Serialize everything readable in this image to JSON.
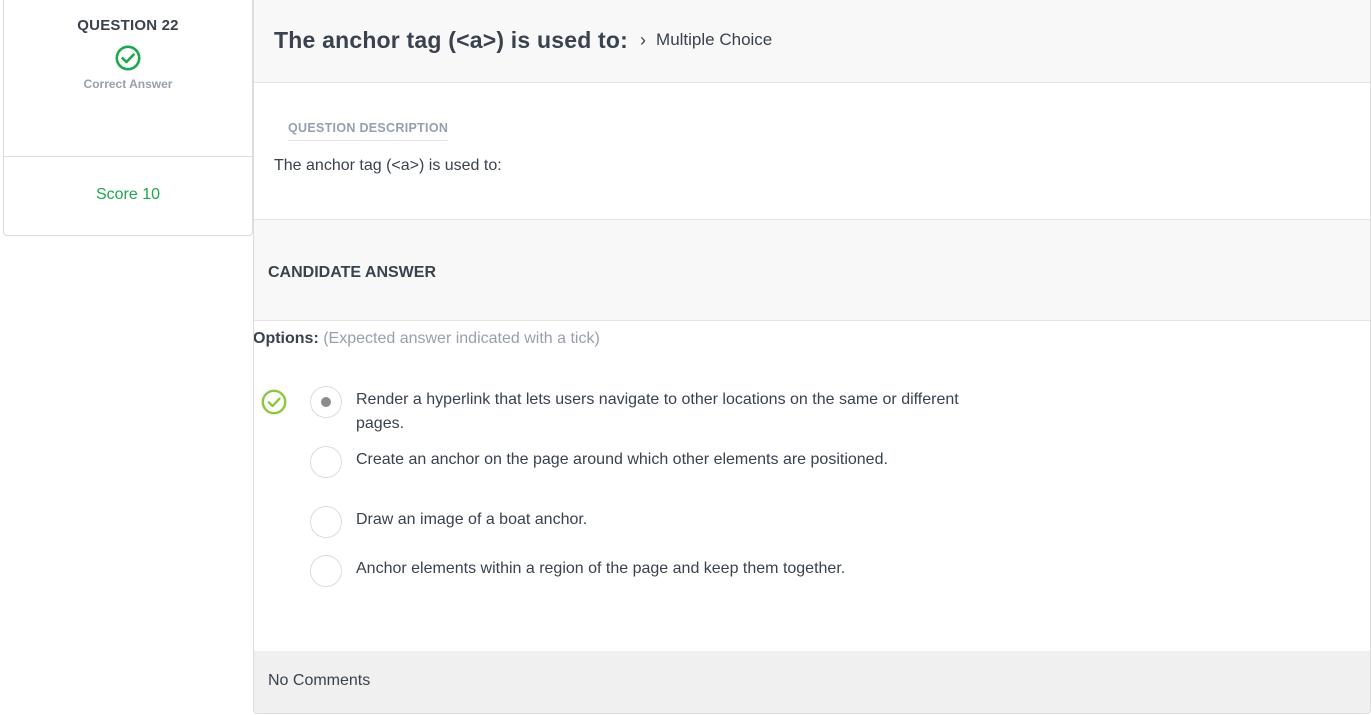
{
  "sidebar": {
    "question_number": "QUESTION 22",
    "status_label": "Correct Answer",
    "score_label": "Score 10"
  },
  "header": {
    "title": "The anchor tag (<a>) is used to:",
    "chevron": "›",
    "question_type": "Multiple Choice"
  },
  "description": {
    "label": "QUESTION DESCRIPTION",
    "text": "The anchor tag (<a>) is used to:"
  },
  "candidate": {
    "section_title": "CANDIDATE ANSWER",
    "options_label": "Options:",
    "options_hint": "(Expected answer indicated with a tick)",
    "options": [
      {
        "text": "Render a hyperlink that lets users navigate to other locations on the same or different pages.",
        "selected": true,
        "expected": true
      },
      {
        "text": "Create an anchor on the page around which other elements are positioned.",
        "selected": false,
        "expected": false
      },
      {
        "text": "Draw an image of a boat anchor.",
        "selected": false,
        "expected": false
      },
      {
        "text": "Anchor elements within a region of the page and keep them together.",
        "selected": false,
        "expected": false
      }
    ]
  },
  "comments": {
    "text": "No Comments"
  },
  "colors": {
    "success": "#1ba94c",
    "tick": "#8dc63f",
    "muted": "#979faf",
    "text": "#39424e"
  },
  "icons": {
    "status": "check-circle-icon",
    "expected": "tick-circle-icon"
  }
}
